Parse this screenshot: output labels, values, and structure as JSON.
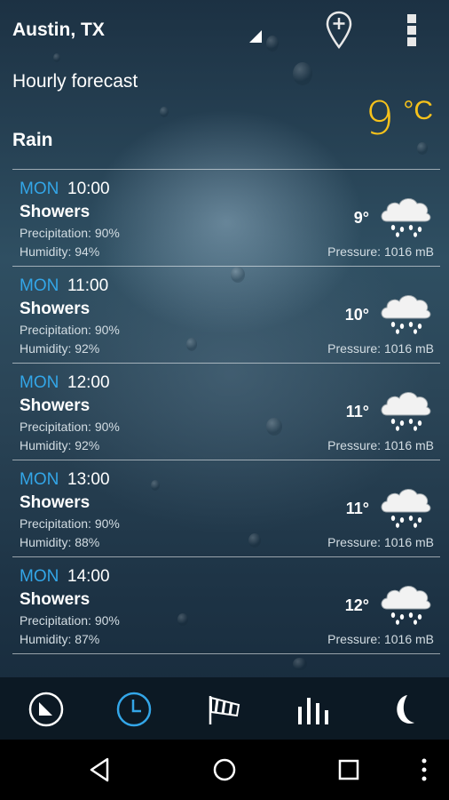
{
  "header": {
    "location": "Austin, TX",
    "section_title": "Hourly forecast",
    "current_temp": "9",
    "temp_unit": "°C",
    "condition": "Rain"
  },
  "colors": {
    "accent_blue": "#33a6e8",
    "temp_yellow": "#f6c21b"
  },
  "hours": [
    {
      "day": "MON",
      "time": "10:00",
      "summary": "Showers",
      "precip": "Precipitation: 90%",
      "humidity": "Humidity: 94%",
      "temp": "9°",
      "pressure": "Pressure: 1016 mB",
      "icon": "rain-cloud-icon"
    },
    {
      "day": "MON",
      "time": "11:00",
      "summary": "Showers",
      "precip": "Precipitation: 90%",
      "humidity": "Humidity: 92%",
      "temp": "10°",
      "pressure": "Pressure: 1016 mB",
      "icon": "rain-cloud-icon"
    },
    {
      "day": "MON",
      "time": "12:00",
      "summary": "Showers",
      "precip": "Precipitation: 90%",
      "humidity": "Humidity: 92%",
      "temp": "11°",
      "pressure": "Pressure: 1016 mB",
      "icon": "rain-cloud-icon"
    },
    {
      "day": "MON",
      "time": "13:00",
      "summary": "Showers",
      "precip": "Precipitation: 90%",
      "humidity": "Humidity: 88%",
      "temp": "11°",
      "pressure": "Pressure: 1016 mB",
      "icon": "rain-cloud-icon"
    },
    {
      "day": "MON",
      "time": "14:00",
      "summary": "Showers",
      "precip": "Precipitation: 90%",
      "humidity": "Humidity: 87%",
      "temp": "12°",
      "pressure": "Pressure: 1016 mB",
      "icon": "rain-cloud-icon"
    }
  ],
  "bottom_tabs": [
    {
      "icon": "current-weather-icon",
      "active": false
    },
    {
      "icon": "hourly-clock-icon",
      "active": true
    },
    {
      "icon": "wind-sock-icon",
      "active": false
    },
    {
      "icon": "chart-bars-icon",
      "active": false
    },
    {
      "icon": "moon-icon",
      "active": false
    }
  ],
  "nav": [
    "back-icon",
    "home-icon",
    "recents-icon",
    "menu-icon"
  ]
}
